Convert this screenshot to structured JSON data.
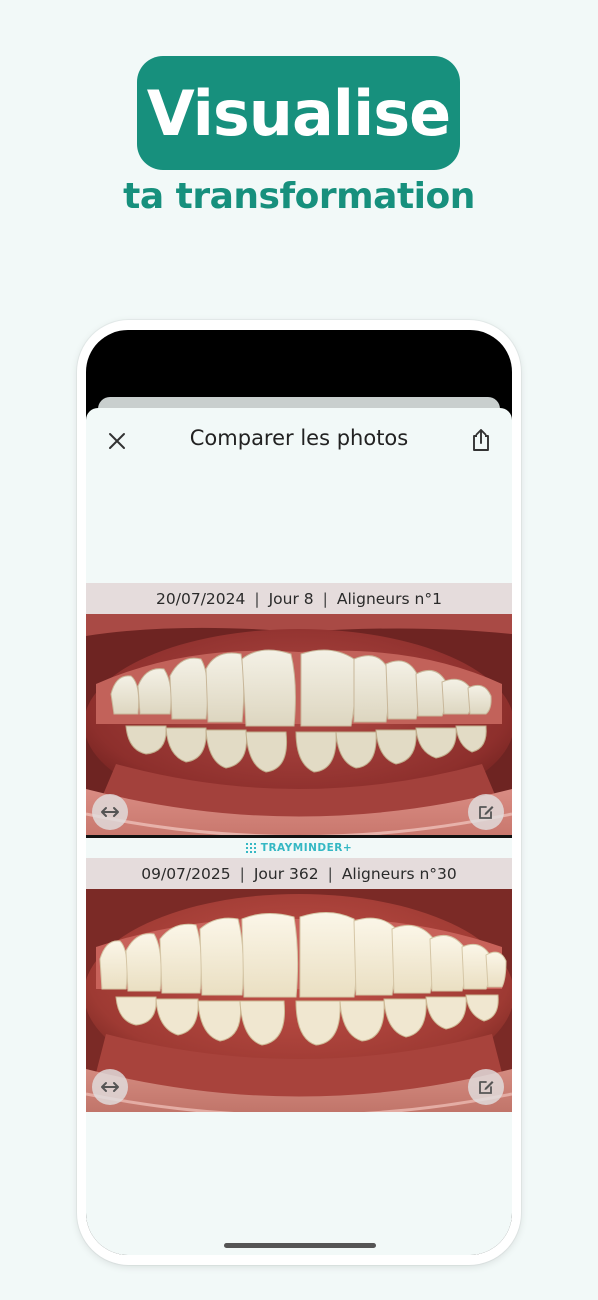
{
  "promo": {
    "headline": "Visualise",
    "subheadline": "ta transformation"
  },
  "modal": {
    "title": "Comparer les photos",
    "close_icon": "close-icon",
    "share_icon": "share-icon"
  },
  "photos": [
    {
      "date": "20/07/2024",
      "day": "Jour 8",
      "aligner": "Aligneurs n°1",
      "swap_icon": "swap-horizontal-icon",
      "edit_icon": "edit-icon"
    },
    {
      "date": "09/07/2025",
      "day": "Jour 362",
      "aligner": "Aligneurs n°30",
      "swap_icon": "swap-horizontal-icon",
      "edit_icon": "edit-icon"
    }
  ],
  "brand": {
    "name": "TRAYMINDER+",
    "icon": "grid-icon"
  },
  "colors": {
    "brand_green": "#17907d",
    "background": "#f2f9f8",
    "brand_teal": "#35b8c4"
  }
}
